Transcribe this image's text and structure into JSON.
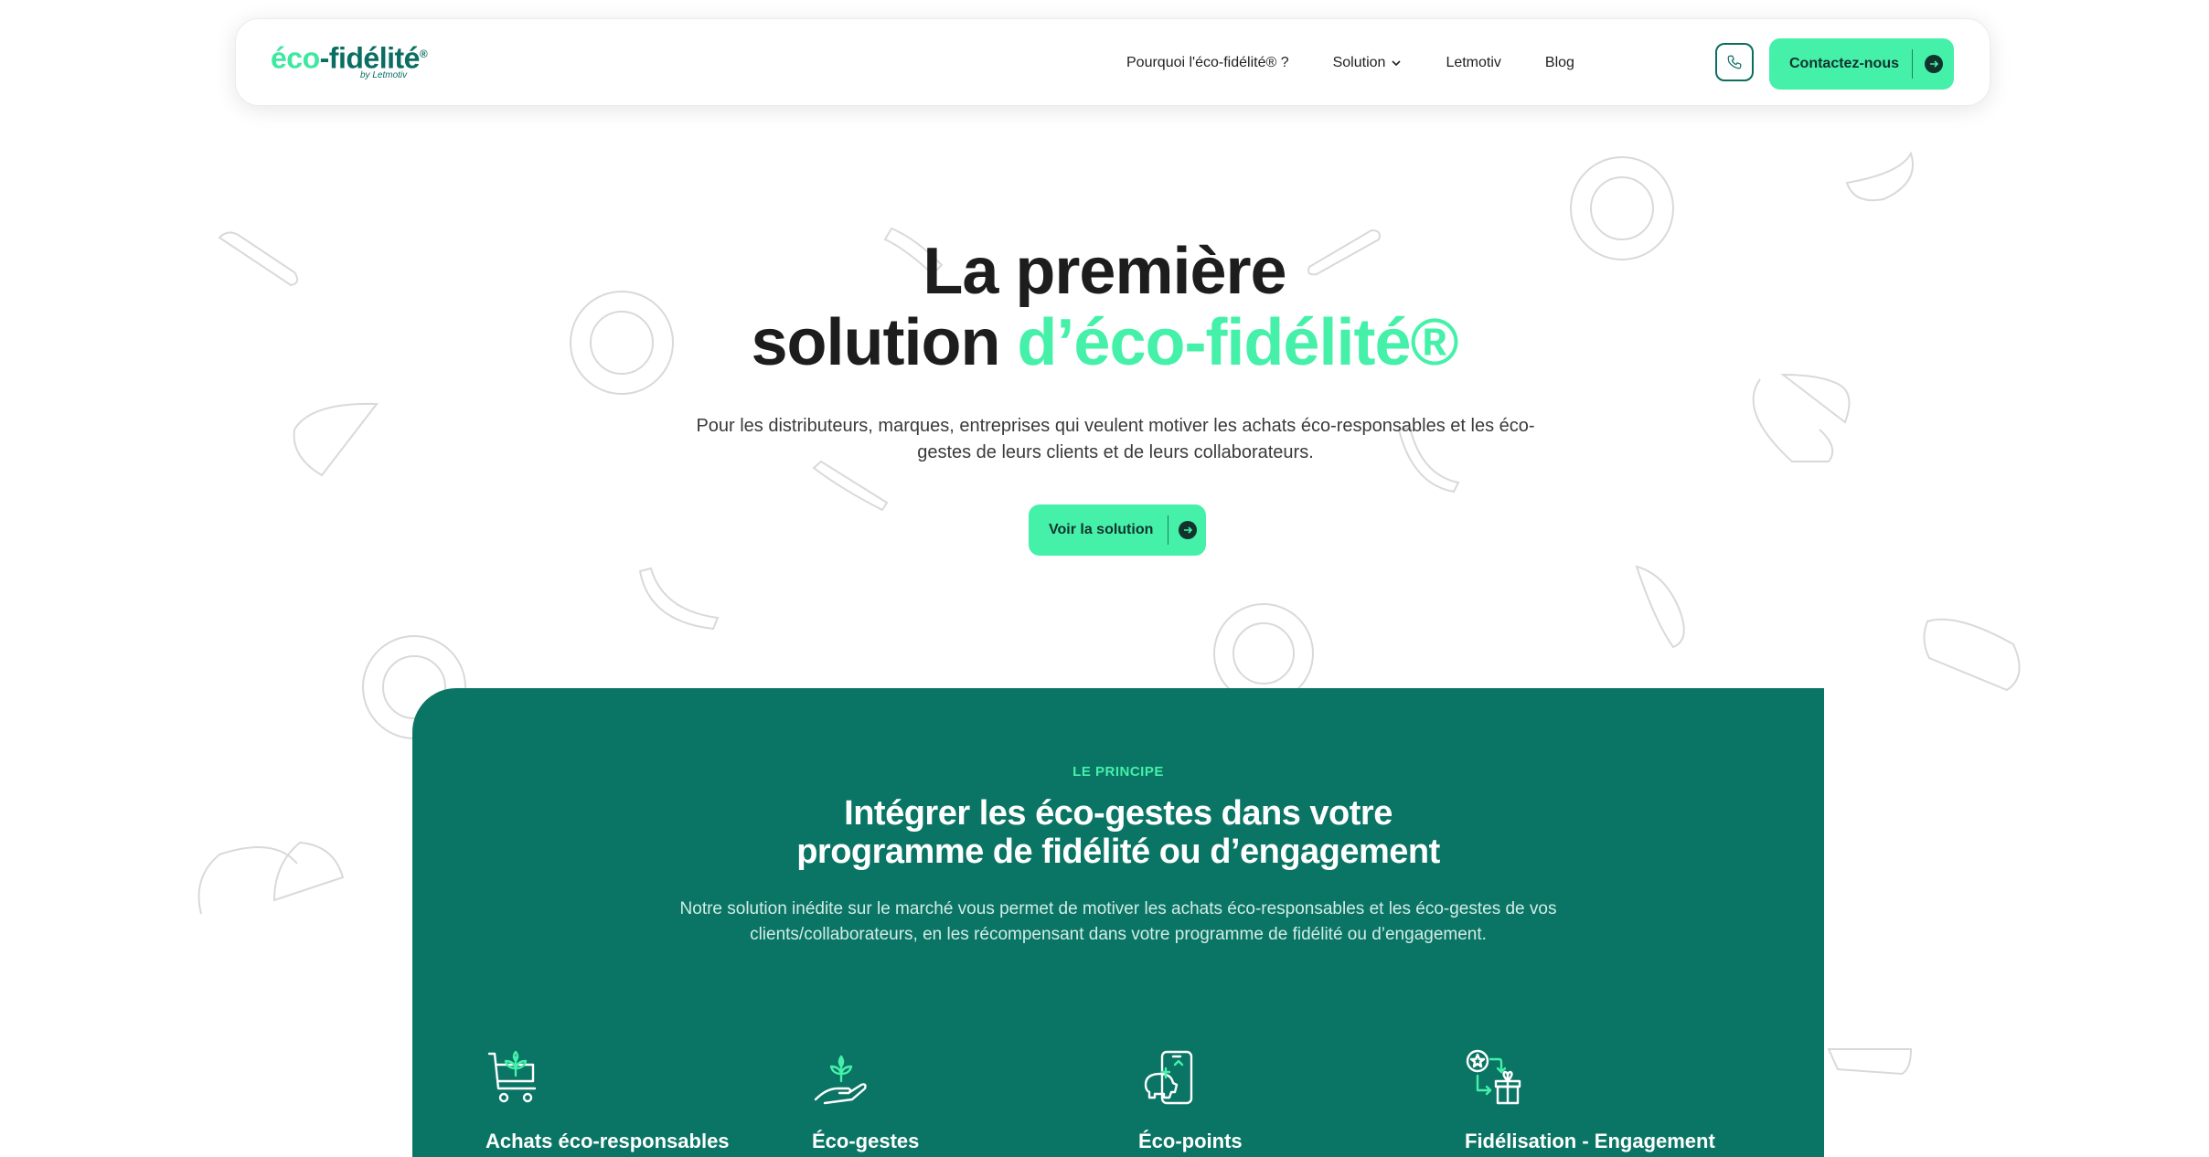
{
  "brand": {
    "logo_eco": "éco",
    "logo_rest": "-fidélité",
    "logo_mark": "®",
    "logo_sub": "by Letmotiv",
    "accent_color": "#45f0a9",
    "dark_green": "#0a7565"
  },
  "nav": {
    "items": [
      "Pourquoi l'éco-fidélité® ?",
      "Solution",
      "Letmotiv",
      "Blog"
    ],
    "phone_icon": "phone-icon",
    "contact_label": "Contactez-nous"
  },
  "hero": {
    "title_line1": "La première",
    "title_line2_plain": "solution ",
    "title_line2_accent": "d’éco-fidélité®",
    "subtitle": "Pour les distributeurs, marques, entreprises qui veulent motiver les achats éco-responsables et les éco-gestes de leurs clients et de leurs collaborateurs.",
    "cta_label": "Voir la solution"
  },
  "principe": {
    "eyebrow": "LE PRINCIPE",
    "title_line1": "Intégrer les éco-gestes dans votre",
    "title_line2": "programme de fidélité ou d’engagement",
    "description": "Notre solution inédite sur le marché vous permet de motiver les achats éco-responsables et les éco-gestes de vos clients/collaborateurs, en les récompensant dans votre programme de fidélité ou d’engagement.",
    "features": [
      {
        "icon": "cart-leaf-icon",
        "label": "Achats éco-responsables"
      },
      {
        "icon": "hand-leaf-icon",
        "label": "Éco-gestes"
      },
      {
        "icon": "phone-piggybank-icon",
        "label": "Éco-points"
      },
      {
        "icon": "star-gift-icon",
        "label": "Fidélisation - Engagement"
      }
    ]
  }
}
